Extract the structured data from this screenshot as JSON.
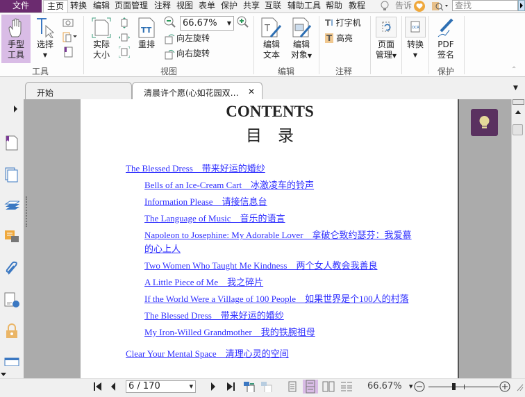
{
  "menu": {
    "file": "文件",
    "home": "主页",
    "items": [
      "转换",
      "编辑",
      "页面管理",
      "注释",
      "视图",
      "表单",
      "保护",
      "共享",
      "互联",
      "辅助工具",
      "帮助",
      "教程"
    ],
    "tell": "告诉",
    "search_placeholder": "查找"
  },
  "ribbon": {
    "hand_tool": "手型工具",
    "hand_line1": "手型",
    "hand_line2": "工具",
    "select": "选择",
    "actual1": "实际",
    "actual2": "大小",
    "reflow": "重排",
    "zoom_value": "66.67%",
    "rotate_left": "向左旋转",
    "rotate_right": "向右旋转",
    "edit_text1": "编辑",
    "edit_text2": "文本",
    "edit_obj1": "编辑",
    "edit_obj2": "对象",
    "typewriter": "打字机",
    "highlight": "高亮",
    "page_mgmt1": "页面",
    "page_mgmt2": "管理",
    "convert": "转换",
    "pdf_sign1": "PDF",
    "pdf_sign2": "签名",
    "groups": {
      "tools": "工具",
      "view": "视图",
      "edit": "编辑",
      "comment": "注释",
      "protect": "保护"
    },
    "active_color": "#d9bce6"
  },
  "tabs": [
    {
      "label": "开始"
    },
    {
      "label": "清晨许个愿(心如花园双…",
      "close": "✕"
    }
  ],
  "document": {
    "title": "CONTENTS",
    "subtitle": "目　录",
    "entries": [
      {
        "level": 1,
        "text": "The Blessed Dress　带来好运的婚纱"
      },
      {
        "level": 2,
        "text": "Bells of an Ice-Cream Cart　冰激凌车的铃声"
      },
      {
        "level": 2,
        "text": "Information Please　请接信息台"
      },
      {
        "level": 2,
        "text": "The Language of Music　音乐的语言"
      },
      {
        "level": 2,
        "text": "Napoleon to Josephine: My Adorable Lover　拿破仑致约瑟芬：我爱慕的心上人"
      },
      {
        "level": 2,
        "text": "Two Women Who Taught Me Kindness　两个女人教会我善良"
      },
      {
        "level": 2,
        "text": "A Little Piece of Me　我之碎片"
      },
      {
        "level": 2,
        "text": "If the World Were a Village of 100 People　如果世界是个100人的村落"
      },
      {
        "level": 2,
        "text": "The Blessed Dress　带来好运的婚纱"
      },
      {
        "level": 2,
        "text": "My Iron-Willed Grandmother　我的铁腕祖母"
      },
      {
        "level": 1,
        "text": "Clear Your Mental Space　清理心灵的空间"
      }
    ],
    "link_color": "#2f2fff"
  },
  "status": {
    "page": "6 / 170",
    "zoom": "66.67%",
    "zoom_slider_fraction": 0.35
  },
  "colors": {
    "brand": "#6b2b6f",
    "bulb_bg": "#5a3160",
    "bulb": "#e6d99a"
  }
}
